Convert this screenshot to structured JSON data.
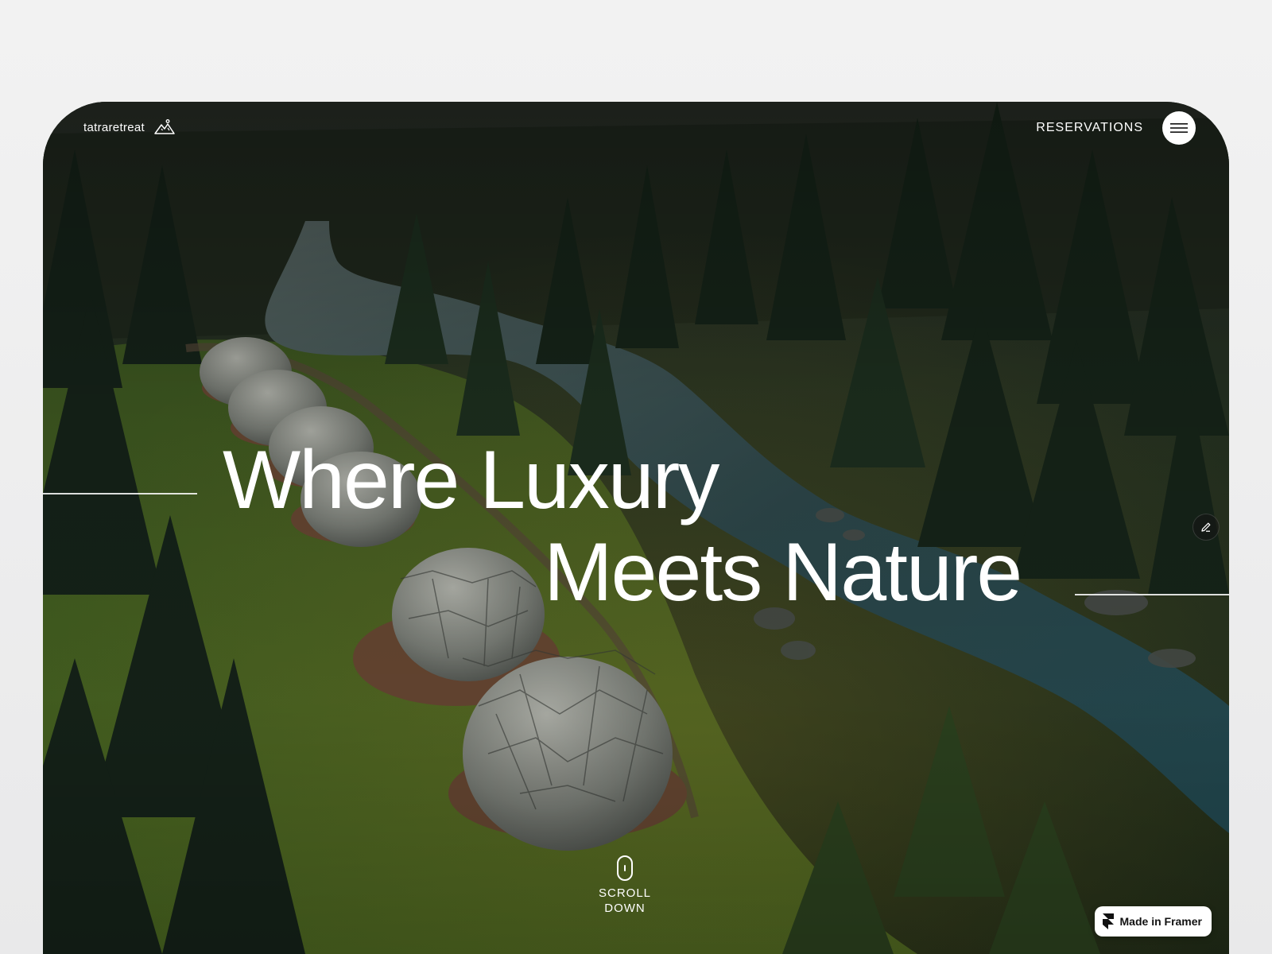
{
  "header": {
    "logo_text": "tatraretreat",
    "logo_icon": "mountain-icon",
    "reservations_label": "RESERVATIONS",
    "menu_icon": "hamburger-icon"
  },
  "hero": {
    "headline_line1": "Where Luxury",
    "headline_line2": "Meets Nature",
    "scroll_line1": "SCROLL",
    "scroll_line2": "DOWN",
    "scroll_icon": "mouse-icon",
    "edit_icon": "pencil-icon"
  },
  "badge": {
    "label": "Made in Framer",
    "icon": "framer-icon"
  },
  "colors": {
    "page_background": "#efefef",
    "text_on_image": "#ffffff",
    "badge_background": "#ffffff",
    "badge_text": "#111111"
  }
}
